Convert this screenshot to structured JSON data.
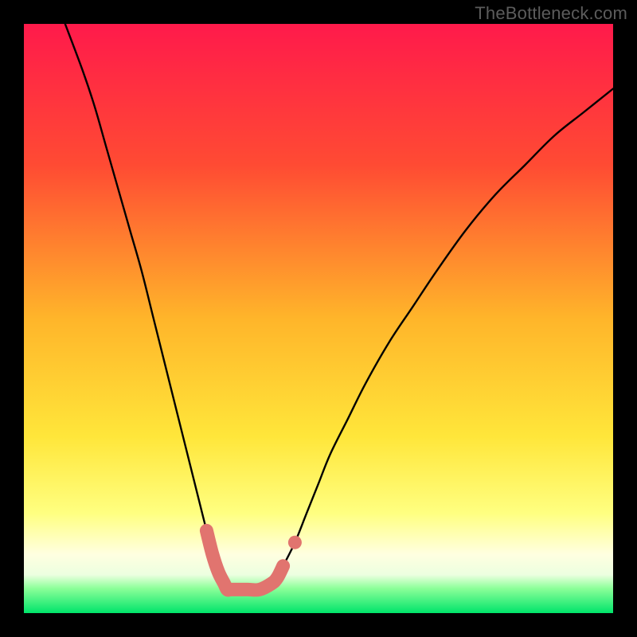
{
  "attribution": "TheBottleneck.com",
  "chart_data": {
    "type": "line",
    "title": "",
    "xlabel": "",
    "ylabel": "",
    "xlim": [
      0,
      100
    ],
    "ylim": [
      0,
      100
    ],
    "gradient_stops": [
      {
        "offset": 0.0,
        "color": "#ff1a4b"
      },
      {
        "offset": 0.24,
        "color": "#ff4b33"
      },
      {
        "offset": 0.5,
        "color": "#ffb52a"
      },
      {
        "offset": 0.7,
        "color": "#ffe63a"
      },
      {
        "offset": 0.83,
        "color": "#ffff80"
      },
      {
        "offset": 0.9,
        "color": "#ffffe0"
      },
      {
        "offset": 0.935,
        "color": "#ecffe0"
      },
      {
        "offset": 0.958,
        "color": "#8cff99"
      },
      {
        "offset": 1.0,
        "color": "#00e46a"
      }
    ],
    "series": [
      {
        "name": "bottleneck-curve",
        "x": [
          7,
          10,
          12,
          14,
          16,
          18,
          20,
          22,
          24,
          26,
          28,
          30,
          31,
          32,
          33,
          34,
          34.5,
          35,
          36,
          38,
          40,
          42,
          43,
          44,
          46,
          48,
          50,
          52,
          55,
          58,
          62,
          66,
          70,
          75,
          80,
          85,
          90,
          95,
          100
        ],
        "values": [
          100,
          92,
          86,
          79,
          72,
          65,
          58,
          50,
          42,
          34,
          26,
          18,
          14,
          10,
          7,
          5,
          4,
          4,
          4,
          4,
          4,
          5,
          6,
          8,
          12,
          17,
          22,
          27,
          33,
          39,
          46,
          52,
          58,
          65,
          71,
          76,
          81,
          85,
          89
        ]
      }
    ],
    "markers": {
      "name": "highlight-band",
      "color": "#e1746f",
      "thick_path": {
        "x": [
          31,
          32,
          33,
          34,
          34.5,
          35,
          36,
          38,
          40,
          42,
          43,
          44
        ],
        "values": [
          14,
          10,
          7,
          5,
          4,
          4,
          4,
          4,
          4,
          5,
          6,
          8
        ]
      },
      "dot": {
        "x": 46,
        "y": 12
      }
    }
  }
}
